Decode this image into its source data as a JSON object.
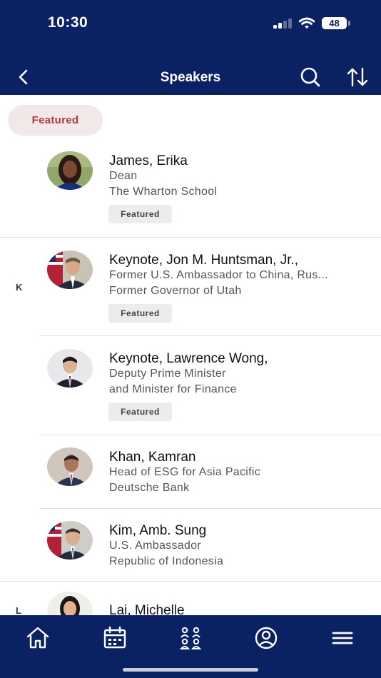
{
  "status_bar": {
    "time": "10:30",
    "battery": "48",
    "signal_icon": "cellular-signal-icon",
    "wifi_icon": "wifi-icon"
  },
  "nav": {
    "title": "Speakers",
    "back_icon": "chevron-left-icon",
    "search_icon": "search-icon",
    "sort_icon": "sort-arrows-icon"
  },
  "filter": {
    "label": "Featured"
  },
  "index_letters": {
    "k": "K",
    "l": "L"
  },
  "speakers": [
    {
      "name": "James, Erika",
      "line1": "Dean",
      "line2": "The Wharton School",
      "tag": "Featured"
    },
    {
      "name": "Keynote, Jon M. Huntsman, Jr.,",
      "line1": "Former U.S. Ambassador to China, Rus...",
      "line2": "Former Governor of Utah",
      "tag": "Featured"
    },
    {
      "name": "Keynote, Lawrence Wong,",
      "line1": "Deputy Prime Minister",
      "line2": "and Minister for Finance",
      "tag": "Featured"
    },
    {
      "name": "Khan, Kamran",
      "line1": "Head of ESG for Asia Pacific",
      "line2": "Deutsche Bank"
    },
    {
      "name": "Kim, Amb. Sung",
      "line1": "U.S. Ambassador",
      "line2": "Republic of Indonesia"
    },
    {
      "name": "Lai, Michelle"
    }
  ],
  "tab_bar": {
    "tabs": [
      "home-icon",
      "calendar-icon",
      "attendees-icon",
      "profile-icon",
      "menu-icon"
    ]
  },
  "colors": {
    "header_bg": "#0a2263",
    "pill_bg": "#f2e8e8",
    "pill_text": "#b03a3a",
    "tag_bg": "#ececec"
  }
}
